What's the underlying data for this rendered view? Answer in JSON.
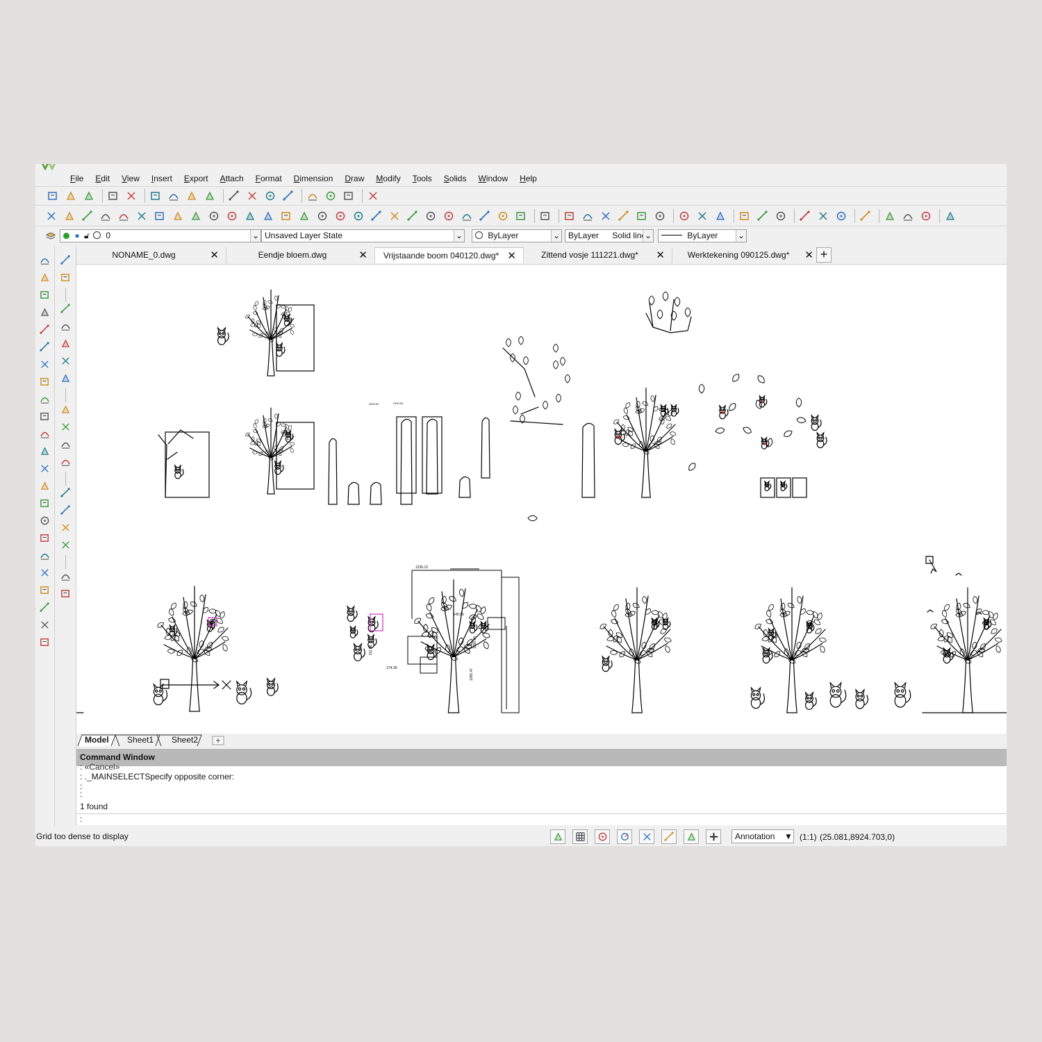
{
  "menu": [
    "File",
    "Edit",
    "View",
    "Insert",
    "Export",
    "Attach",
    "Format",
    "Dimension",
    "Draw",
    "Modify",
    "Tools",
    "Solids",
    "Window",
    "Help"
  ],
  "toolbar1_icons": [
    "new-file-icon",
    "open-folder-icon",
    "save-icon",
    "print-icon",
    "print-preview-icon",
    "cut-icon",
    "copy-icon",
    "paste-icon",
    "match-properties-icon",
    "undo-icon",
    "undo-dropdown-icon",
    "redo-icon",
    "redo-dropdown-icon",
    "pan-icon",
    "zoom-realtime-icon",
    "zoom-window-icon",
    "design-center-icon"
  ],
  "toolbar2_icons": [
    "erase-icon",
    "delete-duplicates-icon",
    "copy-entity-icon",
    "copy-multiple-icon",
    "mirror-icon",
    "offset-icon",
    "parallel-icon",
    "array-icon",
    "move-icon",
    "rotate-icon",
    "scale-icon",
    "stretch-icon",
    "fillet-icon",
    "chamfer-icon",
    "trim-icon",
    "extend-icon",
    "break-icon",
    "join-icon",
    "explode-icon",
    "edit-block-icon",
    "layer-icon",
    "layer-freeze-icon",
    "align-icon",
    "group-icon",
    "ungroup-icon",
    "select-similar-icon",
    "quick-select-icon",
    "check-icon",
    "dimension-linear-icon",
    "dimension-aligned-icon",
    "dimension-angular-icon",
    "dimension-baseline-icon",
    "dimension-continue-icon",
    "dimension-ordinate-icon",
    "snap-center-icon",
    "snap-tangent-icon",
    "snap-perpendicular-icon",
    "polyline-edit-icon",
    "spline-edit-icon",
    "leader-icon",
    "text-edit-icon",
    "text-replace-icon",
    "attribute-icon",
    "block-insert-icon",
    "properties-icon",
    "layer-manager-icon",
    "layer-state-icon",
    "drawing-order-icon"
  ],
  "properties_bar": {
    "layer": "0",
    "layer_state": "Unsaved Layer State",
    "color": "ByLayer",
    "linetype_layer": "ByLayer",
    "linetype": "Solid line",
    "lineweight": "ByLayer"
  },
  "left_toolbar1_icons": [
    "line-icon",
    "construction-line-icon",
    "circle-icon",
    "rectangle-icon",
    "arc-icon",
    "polyline-icon",
    "donut-icon",
    "ellipse-icon",
    "revision-cloud-icon",
    "point-icon",
    "spline-icon",
    "polygon-icon",
    "block-icon",
    "hatch-icon",
    "insert-image-icon",
    "region-icon",
    "text-icon",
    "mtext-icon",
    "table-icon",
    "wipeout-icon",
    "cloud-icon",
    "boundary-icon",
    "attribute-define-icon"
  ],
  "left_toolbar2_icons": [
    "snap-endpoint-icon",
    "snap-midpoint-icon",
    "snap-intersection-icon",
    "snap-apparent-icon",
    "snap-extension-icon",
    "snap-perpendicular-icon",
    "snap-nearest-icon",
    "snap-center-icon",
    "snap-node-icon",
    "snap-quadrant-icon",
    "snap-tangent-icon",
    "snap-insertion-icon",
    "snap-parallel-icon",
    "snap-angle-icon",
    "snap-none-icon",
    "snap-settings-icon",
    "snap-clear-icon"
  ],
  "doc_tabs": [
    {
      "label": "NONAME_0.dwg",
      "active": false
    },
    {
      "label": "Eendje bloem.dwg",
      "active": false
    },
    {
      "label": "Vrijstaande boom 040120.dwg*",
      "active": true
    },
    {
      "label": "Zittend vosje 111221.dwg*",
      "active": false
    },
    {
      "label": "Werktekening 090125.dwg*",
      "active": false
    }
  ],
  "sheet_tabs": [
    "Model",
    "Sheet1",
    "Sheet2"
  ],
  "command": {
    "title": "Command Window",
    "lines": [
      ": «Cancel»",
      ": ._MAINSELECTSpecify opposite corner:",
      ":",
      ":",
      "",
      "1 found"
    ],
    "prompt": ":"
  },
  "status": {
    "message": "Grid too dense to display",
    "annotation_scale_label": "Annotation",
    "scale": "(1:1)",
    "coordinates": "(25.081,8924.703,0)",
    "buttons": [
      "snap-icon",
      "grid-icon",
      "ortho-icon",
      "polar-icon",
      "entity-snap-icon",
      "entity-track-icon",
      "lineweight-icon",
      "tablet-icon"
    ]
  },
  "drawing_labels": [
    "1236.12",
    "145.50",
    "1350.00",
    "1055.47",
    "112.08",
    "274.36",
    "1000.00"
  ],
  "colors": {
    "accent_selection": "#cc33cc",
    "red_detail": "#d32020",
    "canvas": "#ffffff",
    "chrome": "#f0f0f0"
  }
}
